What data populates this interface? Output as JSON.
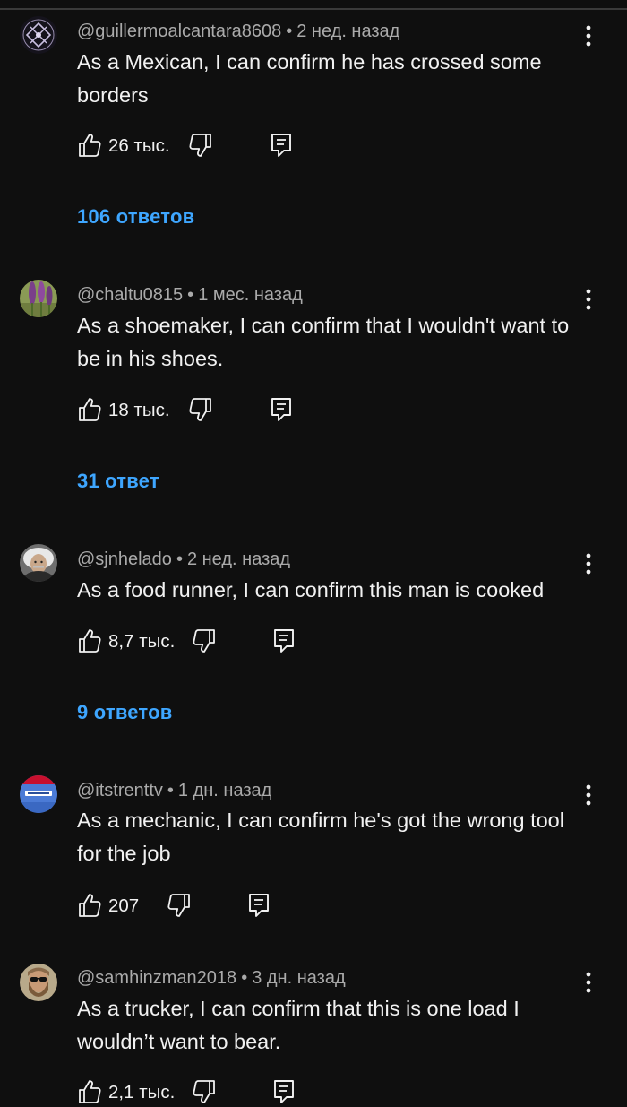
{
  "comments": [
    {
      "author": "@guillermoalcantara8608",
      "time": "2 нед. назад",
      "text": "As a Mexican, I can confirm he has crossed some borders",
      "likes": "26 тыс.",
      "replies": "106 ответов",
      "avatar": "geometric-emblem"
    },
    {
      "author": "@chaltu0815",
      "time": "1 мес. назад",
      "text": "As a shoemaker, I can confirm that I wouldn't want to be in his shoes.",
      "likes": "18 тыс.",
      "replies": "31 ответ",
      "avatar": "purple-flowers"
    },
    {
      "author": "@sjnhelado",
      "time": "2 нед. назад",
      "text": "As a food runner, I can confirm this man is cooked",
      "likes": "8,7 тыс.",
      "replies": "9 ответов",
      "avatar": "portrait-white-hair"
    },
    {
      "author": "@itstrenttv",
      "time": "1 дн. назад",
      "text": "As a mechanic, I can confirm he's got the wrong tool for the job",
      "likes": "207",
      "replies": "",
      "avatar": "sky-banner"
    },
    {
      "author": "@samhinzman2018",
      "time": "3 дн. назад",
      "text": "As a trucker, I can confirm that this is one load I wouldn’t want to bear.",
      "likes": "2,1 тыс.",
      "replies": "",
      "avatar": "bearded-man-sunglasses"
    }
  ],
  "colors": {
    "background": "#0f0f0f",
    "text": "#f1f1f1",
    "meta": "#aaaaaa",
    "link": "#3ea6ff"
  }
}
